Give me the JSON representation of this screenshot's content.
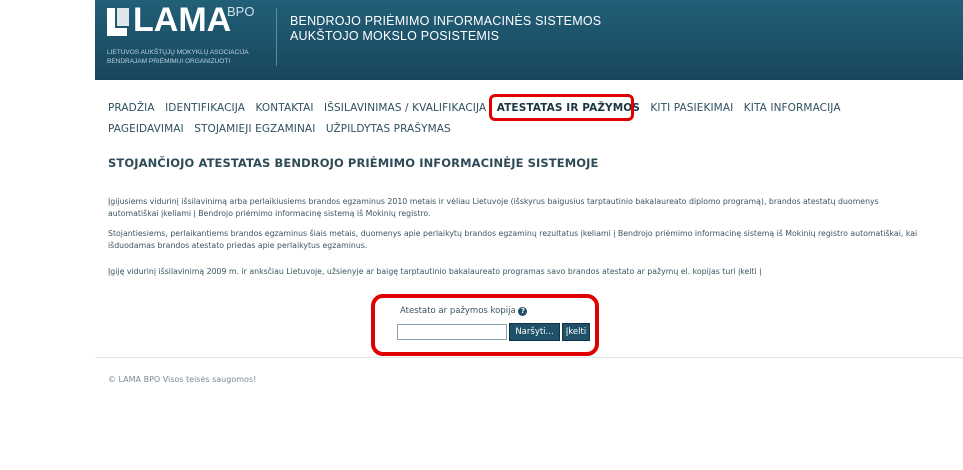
{
  "header": {
    "logo_text": "LAMA",
    "logo_superscript": "BPO",
    "logo_subtitle_line1": "LIETUVOS AUKŠTŲJŲ MOKYKLŲ ASOCIACIJA",
    "logo_subtitle_line2": "BENDRAJAM PRIĖMIMUI ORGANIZUOTI",
    "system_title_line1": "BENDROJO PRIĖMIMO INFORMACINĖS SISTEMOS",
    "system_title_line2": "AUKŠTOJO MOKSLO POSISTEMIS",
    "background_color": "#1a4f66"
  },
  "nav": {
    "items": [
      {
        "label": "PRADŽIA"
      },
      {
        "label": "IDENTIFIKACIJA"
      },
      {
        "label": "KONTAKTAI"
      },
      {
        "label": "IŠSILAVINIMAS / KVALIFIKACIJA"
      },
      {
        "label": "ATESTATAS IR PAŽYMOS",
        "active": true
      },
      {
        "label": "KITI PASIEKIMAI"
      },
      {
        "label": "KITA INFORMACIJA"
      },
      {
        "label": "PAGEIDAVIMAI"
      },
      {
        "label": "STOJAMIEJI EGZAMINAI"
      },
      {
        "label": "UŽPILDYTAS PRAŠYMAS"
      }
    ]
  },
  "main": {
    "heading": "STOJANČIOJO ATESTATAS BENDROJO PRIĖMIMO INFORMACINĖJE SISTEMOJE",
    "paragraph1": "Įgijusiems vidurinį išsilavinimą arba perlaikiusiems brandos egzaminus 2010 metais ir vėliau Lietuvoje (išskyrus baigusius tarptautinio bakalaureato diplomo programą), brandos atestatų duomenys automatiškai įkeliami į Bendrojo priėmimo informacinę sistemą iš Mokinių registro.",
    "paragraph2": "Stojantiesiems, perlaikantiems brandos egzaminus šiais metais, duomenys apie perlaikytų brandos egzaminų rezultatus įkeliami į Bendrojo priėmimo informacinę sistemą iš Mokinių registro automatiškai, kai išduodamas brandos atestato priedas apie perlaikytus egzaminus.",
    "paragraph3": "Įgiję vidurinį išsilavinimą 2009 m. ir anksčiau Lietuvoje, užsienyje ar baigę tarptautinio bakalaureato programas savo brandos atestato ar pažymų el. kopijas turi įkelti į"
  },
  "upload": {
    "label": "Atestato ar pažymos kopija",
    "help_icon_glyph": "?",
    "file_value": "",
    "browse_label": "Naršyti...",
    "upload_label": "Įkelti",
    "button_color": "#1f5168"
  },
  "footer": {
    "text": "© LAMA BPO Visos teisės saugomos!"
  },
  "annotations": {
    "highlight_color": "#e00000"
  }
}
